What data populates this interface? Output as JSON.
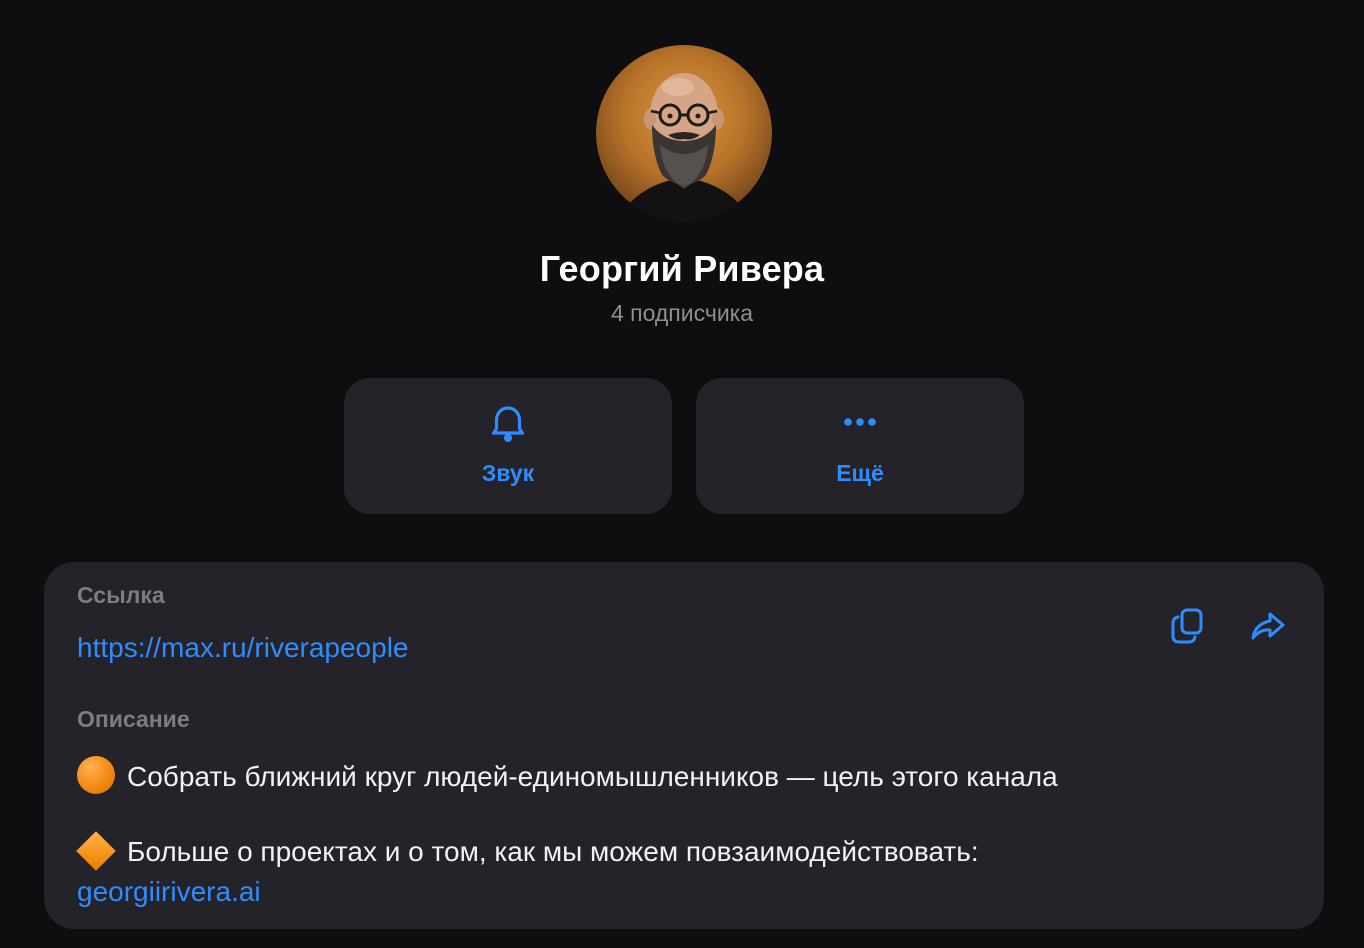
{
  "profile": {
    "name": "Георгий Ривера",
    "subscribers": "4 подписчика"
  },
  "actions": {
    "sound_label": "Звук",
    "sound_icon": "bell-icon",
    "more_label": "Ещё",
    "more_icon": "more-dots-icon"
  },
  "info": {
    "link_title": "Ссылка",
    "link_value": "https://max.ru/riverapeople",
    "copy_icon": "copy-icon",
    "share_icon": "share-icon",
    "description_title": "Описание",
    "description_line1": "Собрать ближний круг людей-единомышленников — цель этого канала",
    "description_line1_emoji": "orange-circle-emoji",
    "description_line2": "Больше о проектах и о том, как мы можем повзаимодействовать:",
    "description_line2_emoji": "orange-diamond-emoji",
    "description_link": "georgiirivera.ai"
  },
  "colors": {
    "background": "#0e0e10",
    "card": "#232329",
    "accent": "#2f8cff",
    "muted": "#8e8e93"
  }
}
